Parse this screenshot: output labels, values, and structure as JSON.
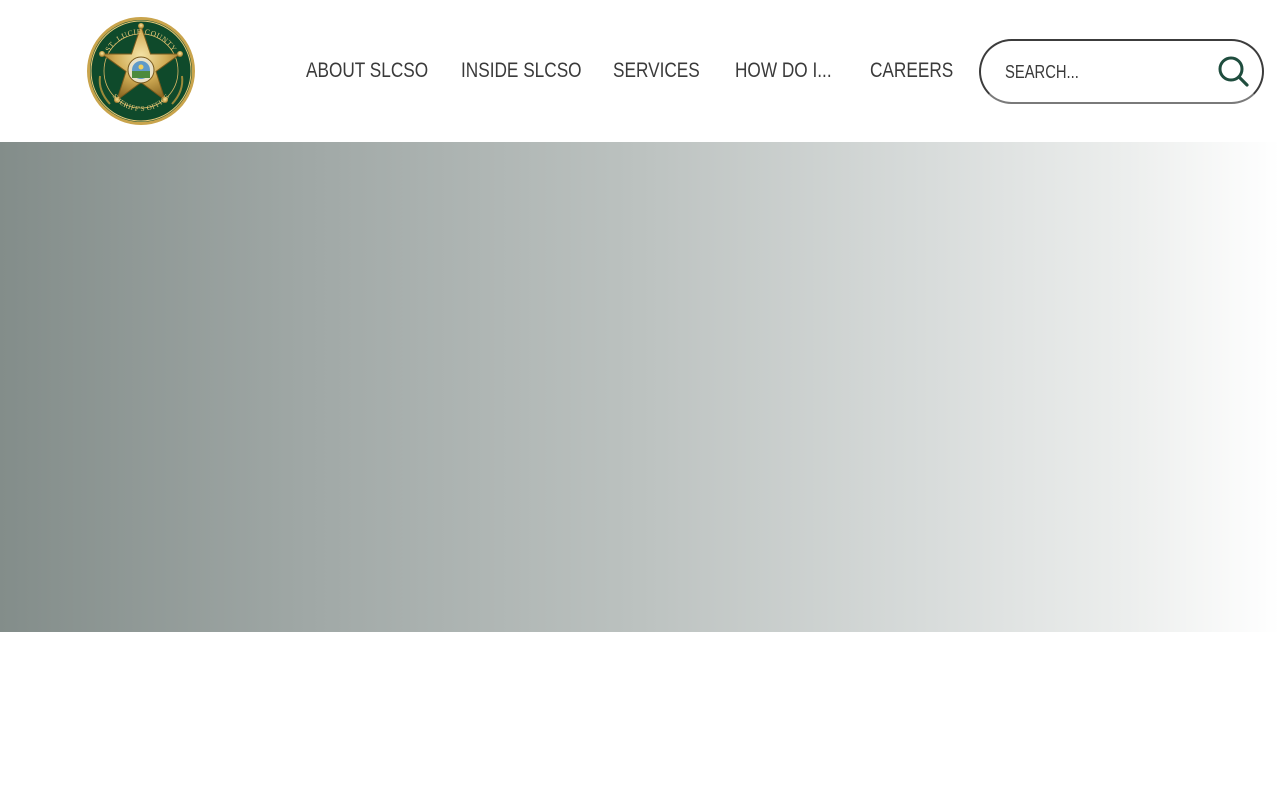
{
  "brand": {
    "logo_alt": "St. Lucie County Sheriff's Office",
    "seal_top_text": "ST. LUCIE COUNTY",
    "seal_bottom_text": "SHERIFF'S OFFICE",
    "colors": {
      "seal_green": "#0f4a2b",
      "gold": "#c9a44c",
      "nav_text": "#3a3a3a",
      "search_icon": "#1f4d3e"
    }
  },
  "nav": {
    "items": [
      {
        "label": "ABOUT SLCSO"
      },
      {
        "label": "INSIDE SLCSO"
      },
      {
        "label": "SERVICES"
      },
      {
        "label": "HOW DO I..."
      },
      {
        "label": "CAREERS"
      }
    ]
  },
  "search": {
    "placeholder": "SEARCH...",
    "value": "",
    "icon": "search-icon"
  },
  "hero": {
    "gradient_start": "#838d8a",
    "gradient_end": "#ffffff"
  }
}
